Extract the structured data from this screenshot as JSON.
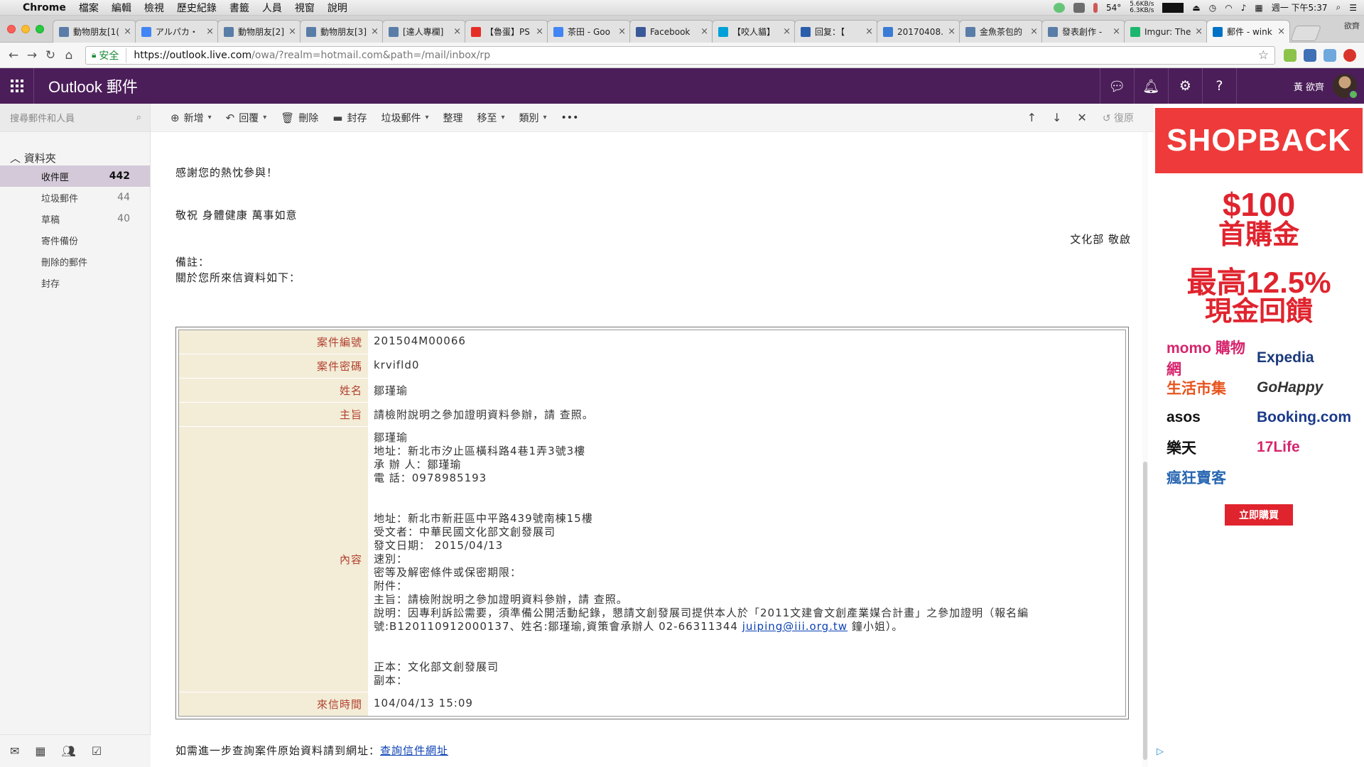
{
  "mac_menubar": {
    "app": "Chrome",
    "menus": [
      "檔案",
      "編輯",
      "檢視",
      "歷史紀錄",
      "書籤",
      "人員",
      "視窗",
      "說明"
    ],
    "temperature": "54°",
    "net_up": "5.6KB/s",
    "net_down": "6.3KB/s",
    "clock": "週一 下午5:37"
  },
  "browser": {
    "tabs": [
      {
        "title": "動物朋友[1(",
        "favicon_color": "#5a7da8",
        "active": false
      },
      {
        "title": "アルパカ・",
        "favicon_color": "#4285f4",
        "active": false
      },
      {
        "title": "動物朋友[2]",
        "favicon_color": "#5a7da8",
        "active": false
      },
      {
        "title": "動物朋友[3]",
        "favicon_color": "#5a7da8",
        "active": false
      },
      {
        "title": "[達人專欄]",
        "favicon_color": "#5a7da8",
        "active": false
      },
      {
        "title": "【魯蛋】PS",
        "favicon_color": "#e52d27",
        "active": false
      },
      {
        "title": "茶田 - Goo",
        "favicon_color": "#4285f4",
        "active": false
      },
      {
        "title": "Facebook",
        "favicon_color": "#3b5998",
        "active": false
      },
      {
        "title": "【咬人貓】",
        "favicon_color": "#00a1d6",
        "active": false
      },
      {
        "title": "回复：【",
        "favicon_color": "#2a5dab",
        "active": false
      },
      {
        "title": "20170408.",
        "favicon_color": "#3a7bd5",
        "active": false
      },
      {
        "title": "金魚茶包的",
        "favicon_color": "#5a7da8",
        "active": false
      },
      {
        "title": "發表創作 -",
        "favicon_color": "#5a7da8",
        "active": false
      },
      {
        "title": "Imgur: The",
        "favicon_color": "#1bb76e",
        "active": false
      },
      {
        "title": "郵件 - wink",
        "favicon_color": "#0072c6",
        "active": true
      }
    ],
    "profile": "欲齊",
    "security_label": "安全",
    "url_host": "https://outlook.live.com",
    "url_path": "/owa/?realm=hotmail.com&path=/mail/inbox/rp"
  },
  "outlook": {
    "brand": "Outlook 郵件",
    "user_name": "黃 欲齊",
    "search_placeholder": "搜尋郵件和人員",
    "folders_title": "資料夾",
    "folders": [
      {
        "name": "收件匣",
        "count": "442",
        "selected": true
      },
      {
        "name": "垃圾郵件",
        "count": "44",
        "selected": false
      },
      {
        "name": "草稿",
        "count": "40",
        "selected": false
      },
      {
        "name": "寄件備份",
        "count": "",
        "selected": false
      },
      {
        "name": "刪除的郵件",
        "count": "",
        "selected": false
      },
      {
        "name": "封存",
        "count": "",
        "selected": false
      }
    ],
    "commands": {
      "new": "新增",
      "reply": "回覆",
      "delete": "刪除",
      "archive": "封存",
      "junk": "垃圾郵件",
      "sweep": "整理",
      "move": "移至",
      "category": "類別",
      "undo": "復原"
    }
  },
  "email": {
    "thanks": "感謝您的熱忱參與！",
    "greeting": "敬祝 身體健康 萬事如意",
    "signoff": "文化部 敬啟",
    "note_label": "備註：",
    "note_text": "關於您所來信資料如下：",
    "case": {
      "id_label": "案件編號",
      "id": "201504M00066",
      "password_label": "案件密碼",
      "password": "krvifld0",
      "name_label": "姓名",
      "name": "鄒瑾瑜",
      "subject_label": "主旨",
      "subject": "請檢附說明之參加證明資料參辦，請 查照。",
      "content_label": "內容",
      "content_part1": "鄒瑾瑜\n地址：新北市汐止區橫科路4巷1弄3號3樓\n承 辦 人：鄒瑾瑜\n電 話：0978985193\n\n\n地址：新北市新莊區中平路439號南棟15樓\n受文者：中華民國文化部文創發展司\n發文日期： 2015/04/13\n速別：\n密等及解密條件或保密期限：\n附件：\n主旨：請檢附說明之參加證明資料參辦，請 查照。\n說明：因專利訴訟需要，須準備公開活動紀錄，懇請文創發展司提供本人於「2011文建會文創產業媒合計畫」之參加證明（報名編號:B120110912000137、姓名:鄒瑾瑜,資策會承辦人 02-66311344 ",
      "content_email": "juiping@iii.org.tw",
      "content_part2": " 鐘小姐）。\n\n\n正本：文化部文創發展司\n副本：",
      "time_label": "來信時間",
      "time": "104/04/13 15:09"
    },
    "footer_text": "如需進一步查詢案件原始資料請到網址：",
    "footer_link": "查詢信件網址"
  },
  "ad": {
    "brand": "SHOPBACK",
    "amount": "$100",
    "line2": "首購金",
    "rate": "最高12.5%",
    "line4": "現金回饋",
    "partners": [
      "momo 購物網",
      "Expedia",
      "生活市集",
      "GoHappy",
      "asos",
      "Booking.com",
      "樂天",
      "17Life",
      "瘋狂賣客"
    ],
    "cta": "立即購買"
  }
}
